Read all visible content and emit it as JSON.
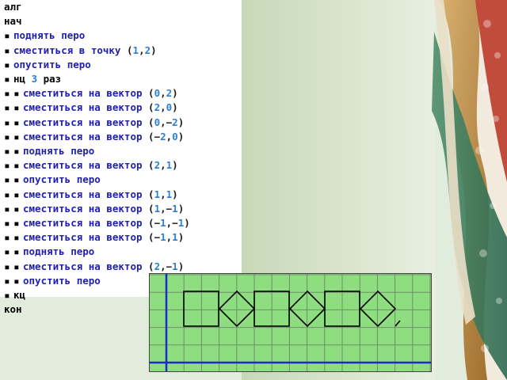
{
  "program": {
    "lines": [
      {
        "depth": 0,
        "parts": [
          {
            "t": "алг",
            "c": "kw"
          }
        ]
      },
      {
        "depth": 0,
        "parts": [
          {
            "t": "нач",
            "c": "kw"
          }
        ]
      },
      {
        "depth": 1,
        "parts": [
          {
            "t": "поднять перо",
            "c": "cmd"
          }
        ]
      },
      {
        "depth": 1,
        "parts": [
          {
            "t": "сместиться в точку",
            "c": "cmd"
          },
          {
            "t": " (",
            "c": "punct"
          },
          {
            "t": "1",
            "c": "num"
          },
          {
            "t": ",",
            "c": "punct"
          },
          {
            "t": "2",
            "c": "num"
          },
          {
            "t": ")",
            "c": "punct"
          }
        ]
      },
      {
        "depth": 1,
        "parts": [
          {
            "t": "опустить перо",
            "c": "cmd"
          }
        ]
      },
      {
        "depth": 1,
        "parts": [
          {
            "t": "нц ",
            "c": "kw"
          },
          {
            "t": "3",
            "c": "num"
          },
          {
            "t": " раз",
            "c": "kw"
          }
        ]
      },
      {
        "depth": 2,
        "parts": [
          {
            "t": "сместиться на вектор",
            "c": "cmd"
          },
          {
            "t": " (",
            "c": "punct"
          },
          {
            "t": "0",
            "c": "num"
          },
          {
            "t": ",",
            "c": "punct"
          },
          {
            "t": "2",
            "c": "num"
          },
          {
            "t": ")",
            "c": "punct"
          }
        ]
      },
      {
        "depth": 2,
        "parts": [
          {
            "t": "сместиться на вектор",
            "c": "cmd"
          },
          {
            "t": " (",
            "c": "punct"
          },
          {
            "t": "2",
            "c": "num"
          },
          {
            "t": ",",
            "c": "punct"
          },
          {
            "t": "0",
            "c": "num"
          },
          {
            "t": ")",
            "c": "punct"
          }
        ]
      },
      {
        "depth": 2,
        "parts": [
          {
            "t": "сместиться на вектор",
            "c": "cmd"
          },
          {
            "t": " (",
            "c": "punct"
          },
          {
            "t": "0",
            "c": "num"
          },
          {
            "t": ",−",
            "c": "punct"
          },
          {
            "t": "2",
            "c": "num"
          },
          {
            "t": ")",
            "c": "punct"
          }
        ]
      },
      {
        "depth": 2,
        "parts": [
          {
            "t": "сместиться на вектор",
            "c": "cmd"
          },
          {
            "t": " (−",
            "c": "punct"
          },
          {
            "t": "2",
            "c": "num"
          },
          {
            "t": ",",
            "c": "punct"
          },
          {
            "t": "0",
            "c": "num"
          },
          {
            "t": ")",
            "c": "punct"
          }
        ]
      },
      {
        "depth": 2,
        "parts": [
          {
            "t": "поднять перо",
            "c": "cmd"
          }
        ]
      },
      {
        "depth": 2,
        "parts": [
          {
            "t": "сместиться на вектор",
            "c": "cmd"
          },
          {
            "t": " (",
            "c": "punct"
          },
          {
            "t": "2",
            "c": "num"
          },
          {
            "t": ",",
            "c": "punct"
          },
          {
            "t": "1",
            "c": "num"
          },
          {
            "t": ")",
            "c": "punct"
          }
        ]
      },
      {
        "depth": 2,
        "parts": [
          {
            "t": "опустить перо",
            "c": "cmd"
          }
        ]
      },
      {
        "depth": 2,
        "parts": [
          {
            "t": "сместиться на вектор",
            "c": "cmd"
          },
          {
            "t": " (",
            "c": "punct"
          },
          {
            "t": "1",
            "c": "num"
          },
          {
            "t": ",",
            "c": "punct"
          },
          {
            "t": "1",
            "c": "num"
          },
          {
            "t": ")",
            "c": "punct"
          }
        ]
      },
      {
        "depth": 2,
        "parts": [
          {
            "t": "сместиться на вектор",
            "c": "cmd"
          },
          {
            "t": " (",
            "c": "punct"
          },
          {
            "t": "1",
            "c": "num"
          },
          {
            "t": ",−",
            "c": "punct"
          },
          {
            "t": "1",
            "c": "num"
          },
          {
            "t": ")",
            "c": "punct"
          }
        ]
      },
      {
        "depth": 2,
        "parts": [
          {
            "t": "сместиться на вектор",
            "c": "cmd"
          },
          {
            "t": " (−",
            "c": "punct"
          },
          {
            "t": "1",
            "c": "num"
          },
          {
            "t": ",−",
            "c": "punct"
          },
          {
            "t": "1",
            "c": "num"
          },
          {
            "t": ")",
            "c": "punct"
          }
        ]
      },
      {
        "depth": 2,
        "parts": [
          {
            "t": "сместиться на вектор",
            "c": "cmd"
          },
          {
            "t": " (−",
            "c": "punct"
          },
          {
            "t": "1",
            "c": "num"
          },
          {
            "t": ",",
            "c": "punct"
          },
          {
            "t": "1",
            "c": "num"
          },
          {
            "t": ")",
            "c": "punct"
          }
        ]
      },
      {
        "depth": 2,
        "parts": [
          {
            "t": "поднять перо",
            "c": "cmd"
          }
        ]
      },
      {
        "depth": 2,
        "parts": [
          {
            "t": "сместиться на вектор",
            "c": "cmd"
          },
          {
            "t": " (",
            "c": "punct"
          },
          {
            "t": "2",
            "c": "num"
          },
          {
            "t": ",−",
            "c": "punct"
          },
          {
            "t": "1",
            "c": "num"
          },
          {
            "t": ")",
            "c": "punct"
          }
        ]
      },
      {
        "depth": 2,
        "parts": [
          {
            "t": "опустить перо",
            "c": "cmd"
          }
        ]
      },
      {
        "depth": 1,
        "parts": [
          {
            "t": "кц",
            "c": "kw"
          }
        ]
      },
      {
        "depth": 0,
        "parts": [
          {
            "t": "кон",
            "c": "kw"
          }
        ]
      }
    ]
  },
  "colors": {
    "keyword": "#000000",
    "command": "#2020b0",
    "number": "#2a7fd4",
    "grid_fill": "#8edd80",
    "axis": "#1a2ad0"
  }
}
